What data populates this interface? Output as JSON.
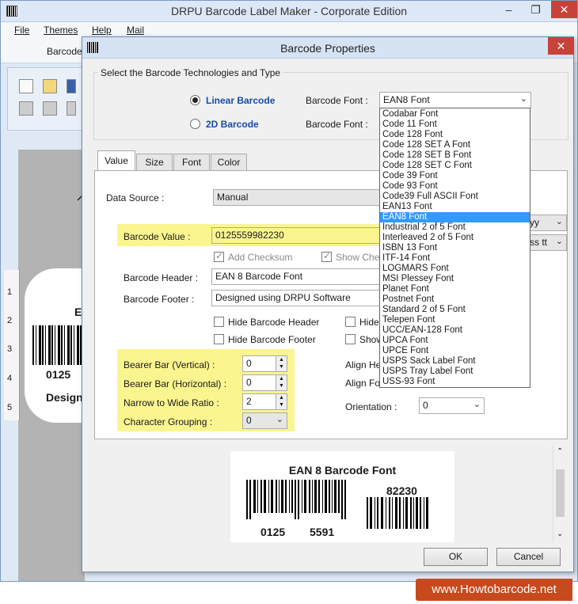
{
  "app": {
    "title": "DRPU Barcode Label Maker - Corporate Edition",
    "menu": [
      "File",
      "Themes",
      "Help",
      "Mail"
    ],
    "ribbon_tab": "Barcode",
    "canvas": {
      "ruler_numbers": [
        "1",
        "2",
        "3",
        "4",
        "5"
      ],
      "card_line1": "0125",
      "card_line2": "Design",
      "card_char": "E"
    }
  },
  "dialog": {
    "title": "Barcode Properties",
    "tech_group_title": "Select the Barcode Technologies and Type",
    "linear_label": "Linear Barcode",
    "twod_label": "2D Barcode",
    "barcode_font_label": "Barcode Font :",
    "linear_font_value": "EAN8 Font",
    "tabs": [
      "Value",
      "Size",
      "Font",
      "Color"
    ],
    "data_source_label": "Data Source :",
    "data_source_value": "Manual",
    "barcode_value_label": "Barcode Value :",
    "barcode_value": "0125559982230",
    "add_checksum": "Add Checksum",
    "show_check": "Show Che",
    "header_label": "Barcode Header :",
    "header_value": "EAN 8 Barcode Font",
    "footer_label": "Barcode Footer :",
    "footer_value": "Designed using DRPU Software",
    "hide_header": "Hide Barcode Header",
    "hide_footer": "Hide Barcode Footer",
    "hide_short": "Hide",
    "show_short": "Show",
    "bearer_vertical_label": "Bearer Bar (Vertical) :",
    "bearer_vertical_value": "0",
    "bearer_horizontal_label": "Bearer Bar (Horizontal) :",
    "bearer_horizontal_value": "0",
    "narrow_wide_label": "Narrow to Wide Ratio :",
    "narrow_wide_value": "2",
    "char_grouping_label": "Character Grouping :",
    "char_grouping_value": "0",
    "align_header_label": "Align He",
    "align_footer_label": "Align Fo",
    "orientation_label": "Orientation :",
    "orientation_value": "0",
    "right_combo1": "yy",
    "right_combo2": "ss tt",
    "preview": {
      "title": "EAN 8 Barcode Font",
      "left_digits": "0125",
      "right_digits": "5591",
      "addon_digits": "82230"
    },
    "ok_label": "OK",
    "cancel_label": "Cancel",
    "font_list": [
      "Codabar Font",
      "Code 11 Font",
      "Code 128 Font",
      "Code 128 SET A Font",
      "Code 128 SET B Font",
      "Code 128 SET C Font",
      "Code 39 Font",
      "Code 93 Font",
      "Code39 Full ASCII Font",
      "EAN13 Font",
      "EAN8 Font",
      "Industrial 2 of 5 Font",
      "Interleaved 2 of 5 Font",
      "ISBN 13 Font",
      "ITF-14 Font",
      "LOGMARS Font",
      "MSI Plessey Font",
      "Planet Font",
      "Postnet Font",
      "Standard 2 of 5 Font",
      "Telepen Font",
      "UCC/EAN-128 Font",
      "UPCA Font",
      "UPCE Font",
      "USPS Sack Label Font",
      "USPS Tray Label Font",
      "USS-93 Font"
    ],
    "font_list_selected_index": 10
  },
  "watermark": "www.Howtobarcode.net",
  "colors": {
    "highlight": "#fbf58f",
    "selection": "#3399ff",
    "accent_label": "#1a4aa6",
    "watermark": "#c84a1c"
  }
}
